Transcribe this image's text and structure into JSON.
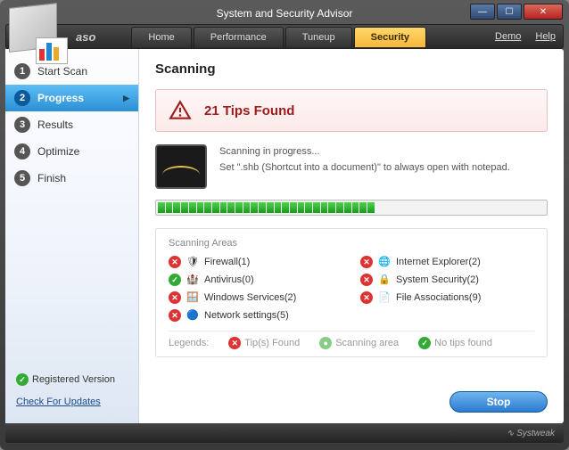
{
  "window": {
    "title": "System and Security Advisor",
    "brand": "aso"
  },
  "nav": {
    "tabs": [
      {
        "label": "Home"
      },
      {
        "label": "Performance"
      },
      {
        "label": "Tuneup"
      },
      {
        "label": "Security"
      }
    ],
    "demo": "Demo",
    "help": "Help"
  },
  "sidebar": {
    "steps": [
      {
        "num": "1",
        "label": "Start Scan"
      },
      {
        "num": "2",
        "label": "Progress"
      },
      {
        "num": "3",
        "label": "Results"
      },
      {
        "num": "4",
        "label": "Optimize"
      },
      {
        "num": "5",
        "label": "Finish"
      }
    ],
    "registered": "Registered Version",
    "check_updates": "Check For Updates"
  },
  "main": {
    "heading": "Scanning",
    "alert": "21 Tips Found",
    "scan_status": "Scanning in progress...",
    "scan_detail": "Set \".shb (Shortcut into a document)\" to always open with notepad.",
    "areas_title": "Scanning Areas",
    "areas": [
      {
        "status": "red",
        "icon": "🛡",
        "label": "Firewall(1)"
      },
      {
        "status": "red",
        "icon": "🌐",
        "label": "Internet Explorer(2)"
      },
      {
        "status": "green",
        "icon": "🏰",
        "label": "Antivirus(0)"
      },
      {
        "status": "red",
        "icon": "🔒",
        "label": "System Security(2)"
      },
      {
        "status": "red",
        "icon": "🪟",
        "label": "Windows Services(2)"
      },
      {
        "status": "red",
        "icon": "📄",
        "label": "File Associations(9)"
      },
      {
        "status": "red",
        "icon": "🔵",
        "label": "Network settings(5)"
      }
    ],
    "legends": {
      "label": "Legends:",
      "tips": "Tip(s) Found",
      "scanning": "Scanning area",
      "notips": "No tips found"
    },
    "stop": "Stop"
  },
  "footer": {
    "brand": "Systweak"
  }
}
